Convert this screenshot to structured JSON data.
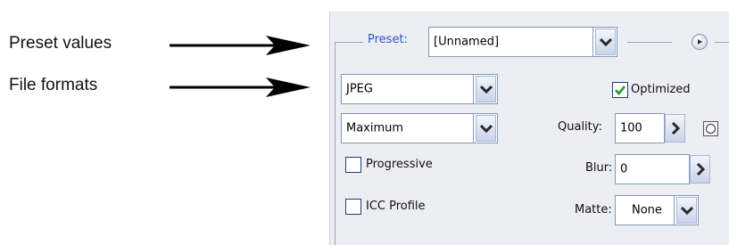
{
  "annotations": [
    {
      "label": "Preset values"
    },
    {
      "label": "File formats"
    }
  ],
  "panel": {
    "preset": {
      "label": "Preset:",
      "value": "[Unnamed]"
    },
    "format": {
      "value": "JPEG"
    },
    "optimized": {
      "label": "Optimized",
      "checked": true
    },
    "compression": {
      "value": "Maximum"
    },
    "quality": {
      "label": "Quality:",
      "value": "100"
    },
    "progressive": {
      "label": "Progressive",
      "checked": false
    },
    "blur": {
      "label": "Blur:",
      "value": "0"
    },
    "icc_profile": {
      "label": "ICC Profile",
      "checked": false
    },
    "matte": {
      "label": "Matte:",
      "value": "None"
    }
  },
  "icons": {
    "arrow": "right-arrow-icon",
    "dropdown": "chevron-down-icon",
    "flyout": "flyout-menu-icon",
    "stepper": "chevron-right-icon",
    "check": "checkmark-icon",
    "mask": "quality-mask-icon"
  },
  "colors": {
    "preset_label": "#2a55c8",
    "panel_background": "#ededf4",
    "check_mark": "#1e9e28"
  }
}
